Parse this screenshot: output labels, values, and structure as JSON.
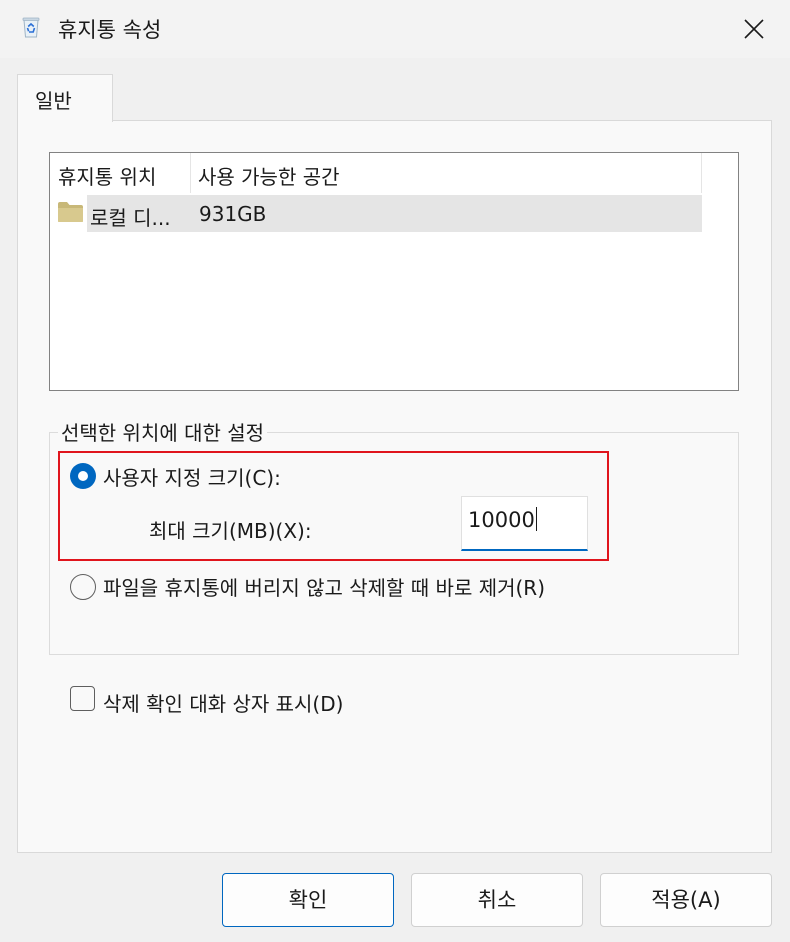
{
  "window": {
    "title": "휴지통 속성",
    "icon": "recycle-bin-icon"
  },
  "tabs": [
    {
      "label": "일반",
      "selected": true
    }
  ],
  "location_list": {
    "columns": [
      "휴지통 위치",
      "사용 가능한 공간"
    ],
    "rows": [
      {
        "location": "로컬 디...",
        "space": "931GB",
        "icon": "folder-icon"
      }
    ]
  },
  "settings": {
    "group_label": "선택한 위치에 대한 설정",
    "custom_size": {
      "label": "사용자 지정 크기(C):",
      "selected": true,
      "max_size_label": "최대 크기(MB)(X):",
      "max_size_value": "10000"
    },
    "delete_immediately": {
      "label": "파일을 휴지통에 버리지 않고 삭제할 때 바로 제거(R)",
      "selected": false
    }
  },
  "confirm_dialog": {
    "label": "삭제 확인 대화 상자 표시(D)",
    "checked": false
  },
  "buttons": {
    "ok": "확인",
    "cancel": "취소",
    "apply": "적용(A)"
  },
  "colors": {
    "accent": "#0067c0",
    "highlight_border": "#e0151d"
  }
}
